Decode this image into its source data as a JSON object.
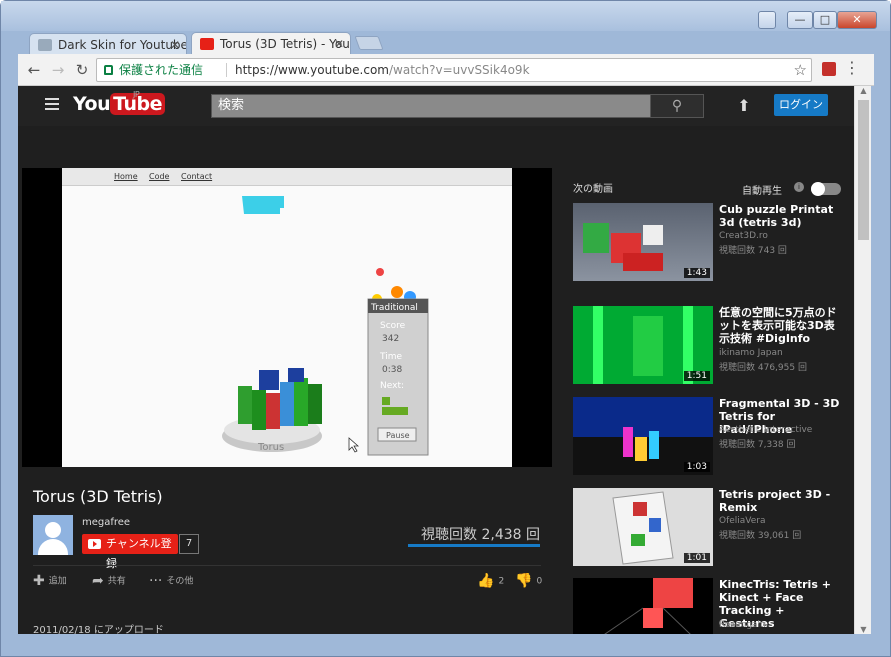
{
  "browser": {
    "tabs": [
      {
        "label": "Dark Skin for Youtube",
        "close": "✕"
      },
      {
        "label": "Torus (3D Tetris) - You",
        "close": "✕"
      }
    ],
    "secure_label": "保護された通信",
    "url_host": "https://www.youtube.com",
    "url_path": "/watch?v=uvvSSik4o9k",
    "nav": {
      "back": "←",
      "forward": "→",
      "reload": "↻"
    },
    "star": "☆",
    "menu": "⋮",
    "window_buttons": {
      "minimize": "—",
      "maximize": "□",
      "close": "✕"
    }
  },
  "youtube": {
    "logo_you": "You",
    "logo_tube": "Tube",
    "logo_region": "JP",
    "search_placeholder": "検索",
    "search_icon": "⚲",
    "upload_icon": "⬆",
    "login_label": "ログイン"
  },
  "game": {
    "nav": [
      "Home",
      "Code",
      "Contact"
    ],
    "mode": "Traditional",
    "score_label": "Score",
    "score": "342",
    "time_label": "Time",
    "time": "0:38",
    "next_label": "Next:",
    "pause_label": "Pause",
    "torus_label": "Torus"
  },
  "video": {
    "title": "Torus (3D Tetris)",
    "channel": "megafree",
    "subscribe_label": "チャンネル登録",
    "subscriber_count": "7",
    "views": "視聴回数 2,438 回",
    "actions": {
      "add": "追加",
      "share": "共有",
      "more": "その他"
    },
    "likes": "2",
    "dislikes": "0",
    "upload_date": "2011/02/18 にアップロード"
  },
  "sidebar": {
    "next_label": "次の動画",
    "autoplay_label": "自動再生",
    "items": [
      {
        "title": "Cub puzzle Printat 3d (tetris 3d)",
        "channel": "Creat3D.ro",
        "views": "視聴回数 743 回",
        "duration": "1:43"
      },
      {
        "title": "任意の空間に5万点のドットを表示可能な3D表示技術 #DigInfo",
        "channel": "ikinamo Japan",
        "views": "視聴回数 476,955 回",
        "duration": "1:51"
      },
      {
        "title": "Fragmental 3D - 3D Tetris for iPad/iPhone",
        "channel": "Aesthetic Interactive",
        "views": "視聴回数 7,338 回",
        "duration": "1:03"
      },
      {
        "title": "Tetris project 3D - Remix",
        "channel": "OfeliaVera",
        "views": "視聴回数 39,061 回",
        "duration": "1:01"
      },
      {
        "title": "KinecTris: Tetris + Kinect + Face Tracking + Gestures",
        "channel": "Rozengain",
        "views": "",
        "duration": ""
      }
    ]
  }
}
